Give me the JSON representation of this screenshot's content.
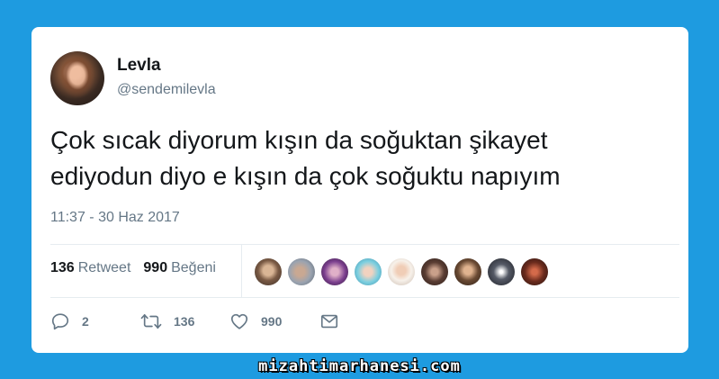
{
  "author": {
    "name": "Levla",
    "handle": "@sendemilevla"
  },
  "tweet": {
    "text_line1": "Çok sıcak diyorum kışın da soğuktan şikayet",
    "text_line2": "ediyodun diyo e kışın da çok soğuktu napıyım",
    "timestamp": "11:37 - 30 Haz 2017"
  },
  "stats": {
    "retweet_count": "136",
    "retweet_label": "Retweet",
    "like_count": "990",
    "like_label": "Beğeni"
  },
  "actions": {
    "reply_count": "2",
    "retweet_count": "136",
    "like_count": "990"
  },
  "watermark": "mizahtimarhanesi.com",
  "colors": {
    "background": "#1e9be0",
    "card": "#ffffff",
    "text_primary": "#14171a",
    "text_secondary": "#657786"
  }
}
